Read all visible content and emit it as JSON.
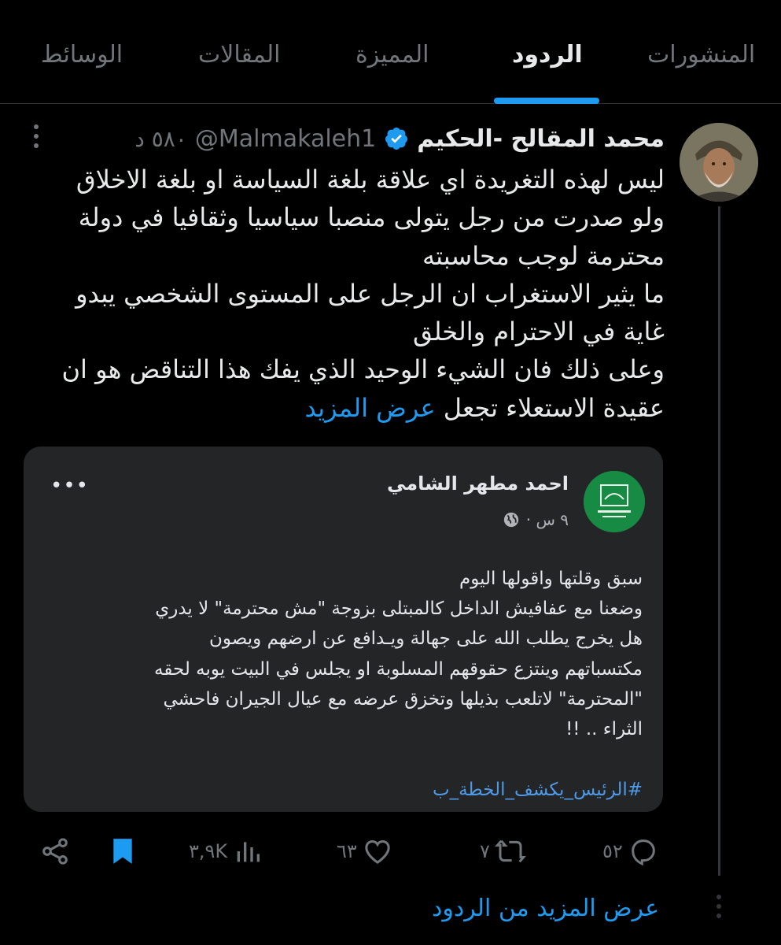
{
  "tabs": [
    {
      "label": "المنشورات"
    },
    {
      "label": "الردود"
    },
    {
      "label": "المميزة"
    },
    {
      "label": "المقالات"
    },
    {
      "label": "الوسائط"
    }
  ],
  "active_tab": "الردود",
  "tweet": {
    "author_name": "محمد المقالح -الحكيم",
    "handle": "@Malmakaleh1",
    "time": "٥٨٠ د",
    "body_lines": [
      "ليس لهذه التغريدة اي علاقة بلغة السياسة او بلغة الاخلاق",
      "ولو صدرت من  رجل يتولى منصبا سياسيا وثقافيا في دولة",
      "محترمة لوجب محاسبته",
      "ما يثير الاستغراب ان الرجل على المستوى الشخصي يبدو",
      "غاية في الاحترام والخلق",
      "وعلى ذلك فان الشيء الوحيد الذي يفك هذا التناقض هو ان",
      "عقيدة الاستعلاء تجعل"
    ],
    "show_more": "عرض المزيد",
    "accent_color": "#1d9bf0"
  },
  "embedded_post": {
    "author_name": "احمد مطهر الشامي",
    "time": "٩ س ·",
    "icon": "globe-icon",
    "more_label": "•••",
    "text_lines": [
      "سبق وقلتها واقولها اليوم",
      "وضعنا مع عفافيش الداخل كالمبتلى بزوجة \"مش محترمة\" لا يدري",
      "هل يخرج يطلب الله على جهالة ويـدافع عن ارضهم ويصون",
      "مكتسباتهم وينتزع حقوقهم المسلوبة او يجلس في البيت يوبه لحقه",
      "\"المحترمة\" لاتلعب بذيلها وتخزق عرضه مع عيال الجيران فاحشي",
      "الثراء .. !!"
    ],
    "hashtag": "#الرئيس_يكشف_الخطة_ب"
  },
  "actions": {
    "replies": "٥٢",
    "retweets": "٧",
    "likes": "٦٣",
    "views": "٣,٩K"
  },
  "more_replies": "عرض المزيد من الردود"
}
